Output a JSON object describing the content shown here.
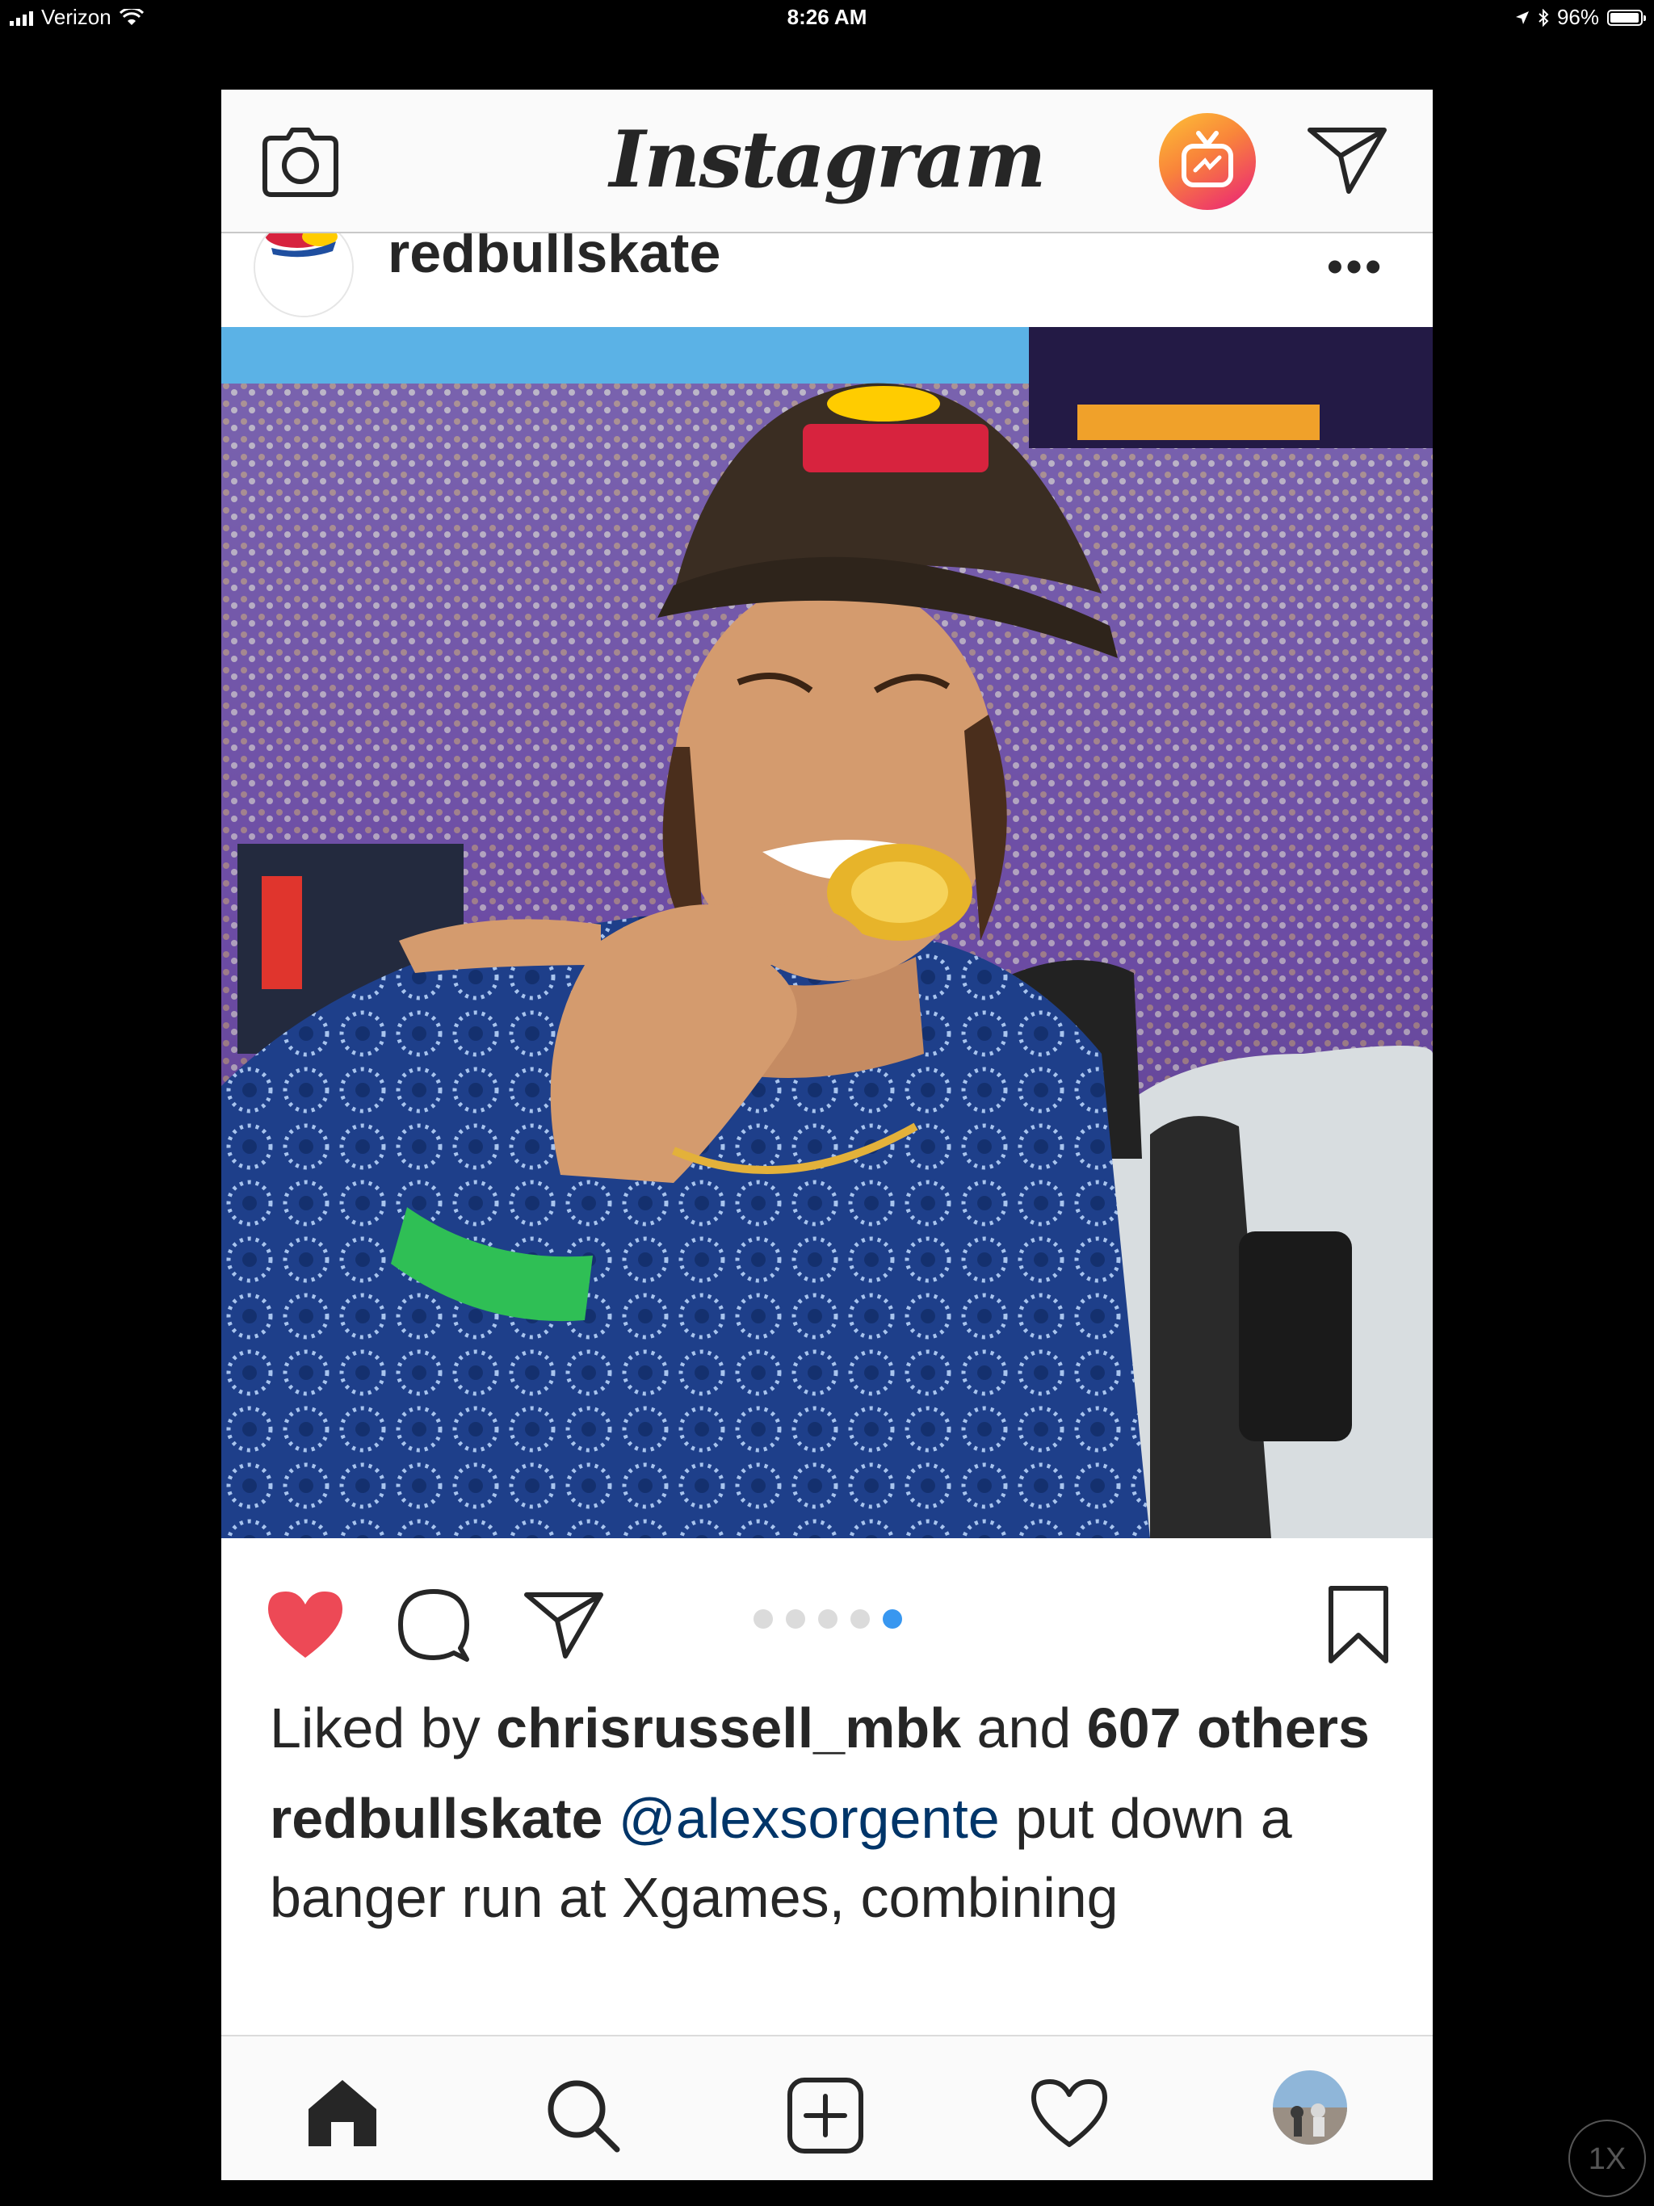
{
  "status_bar": {
    "carrier": "Verizon",
    "time": "8:26 AM",
    "battery_percent": "96%",
    "battery_level": 0.96,
    "icons": [
      "signal-icon",
      "wifi-icon",
      "location-icon",
      "bluetooth-icon",
      "battery-icon"
    ]
  },
  "app": {
    "logo_text": "Instagram",
    "topbar_icons": [
      "camera-icon",
      "igtv-icon",
      "direct-message-icon"
    ],
    "igtv_gradient": [
      "#fdc236",
      "#f9853a",
      "#ee3969"
    ]
  },
  "post": {
    "username": "redbullskate",
    "more_label": "•••",
    "carousel": {
      "count": 5,
      "active_index": 4
    },
    "liked_by_prefix": "Liked by ",
    "liked_by_user": "chrisrussell_mbk",
    "liked_by_and": " and ",
    "liked_by_others": "607 others",
    "caption_username": "redbullskate",
    "caption_mention": "@alexsorgente",
    "caption_text": " put down a banger run at Xgames, combining",
    "colors": {
      "like": "#ed4956",
      "carousel_active": "#3897f0",
      "mention": "#003569"
    }
  },
  "bottom_nav": {
    "items": [
      "home-icon",
      "search-icon",
      "new-post-icon",
      "activity-heart-icon",
      "profile-avatar"
    ]
  },
  "overlay": {
    "zoom_label": "1X"
  }
}
